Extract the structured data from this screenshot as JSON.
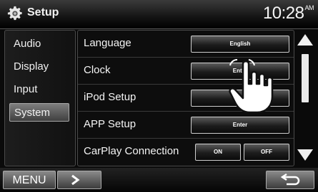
{
  "header": {
    "title": "Setup",
    "time": "10:28",
    "ampm": "AM",
    "icon": "gear-icon"
  },
  "tabs": [
    {
      "label": "Audio",
      "active": false
    },
    {
      "label": "Display",
      "active": false
    },
    {
      "label": "Input",
      "active": false
    },
    {
      "label": "System",
      "active": true
    }
  ],
  "rows": [
    {
      "label": "Language",
      "button": "English"
    },
    {
      "label": "Clock",
      "button": "Enter"
    },
    {
      "label": "iPod Setup",
      "button": "Enter"
    },
    {
      "label": "APP Setup",
      "button": "Enter"
    },
    {
      "label": "CarPlay Connection",
      "on": "ON",
      "off": "OFF"
    }
  ],
  "footer": {
    "menu": "MENU",
    "next_icon": "chevron-right-icon",
    "back_icon": "return-arrow-icon"
  },
  "overlay": {
    "icon": "hand-pointer-icon"
  }
}
